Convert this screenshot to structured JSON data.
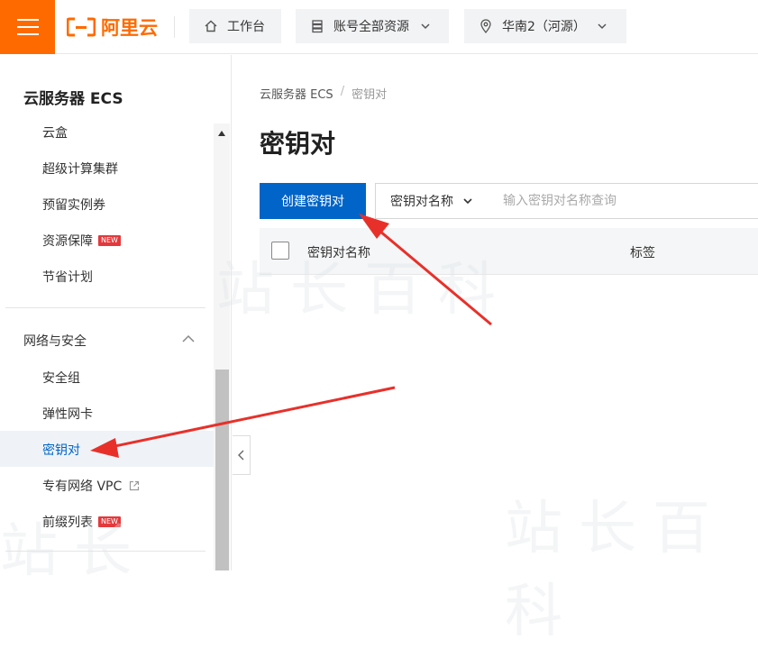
{
  "topbar": {
    "brand": "阿里云",
    "workbench": "工作台",
    "resource_scope": "账号全部资源",
    "region": "华南2（河源）"
  },
  "sidebar": {
    "title": "云服务器 ECS",
    "items_top": [
      {
        "label": "云盒"
      },
      {
        "label": "超级计算集群"
      },
      {
        "label": "预留实例券"
      },
      {
        "label": "资源保障",
        "badge": "NEW"
      },
      {
        "label": "节省计划"
      }
    ],
    "group": "网络与安全",
    "items_group": [
      {
        "label": "安全组"
      },
      {
        "label": "弹性网卡"
      },
      {
        "label": "密钥对",
        "active": true
      },
      {
        "label": "专有网络 VPC"
      },
      {
        "label": "前缀列表",
        "badge": "NEW"
      }
    ]
  },
  "breadcrumb": {
    "parent": "云服务器 ECS",
    "separator": "/",
    "current": "密钥对"
  },
  "page": {
    "title": "密钥对",
    "create_button": "创建密钥对",
    "filter_select": "密钥对名称",
    "search_placeholder": "输入密钥对名称查询"
  },
  "table": {
    "columns": [
      "密钥对名称",
      "标签"
    ]
  },
  "colors": {
    "brand_orange": "#ff6a00",
    "primary_blue": "#0064c8",
    "badge_red": "#e4393c",
    "arrow_red": "#e8302a"
  }
}
